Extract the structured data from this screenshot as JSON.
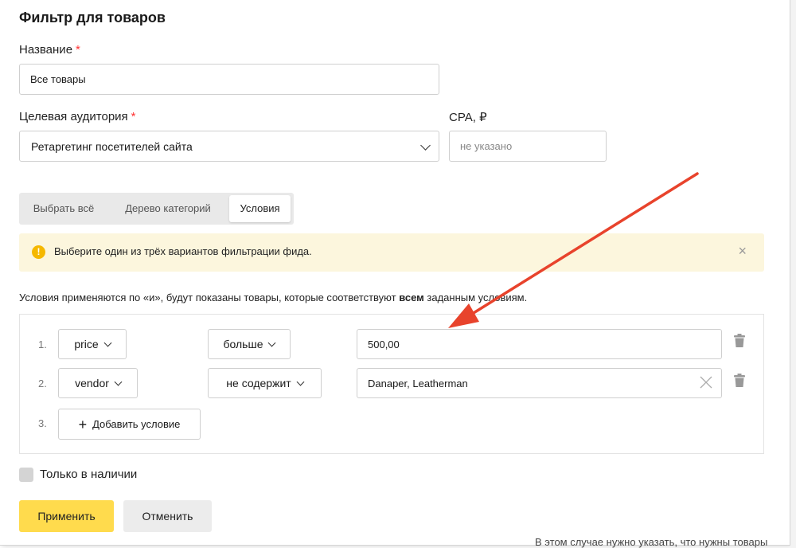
{
  "background": {
    "partial_text": "В этом случае нужно указать, что нужны товары"
  },
  "dialog": {
    "title": "Фильтр для товаров",
    "name_label": "Название",
    "required_mark": "*",
    "name_value": "Все товары",
    "audience_label": "Целевая аудитория",
    "audience_value": "Ретаргетинг посетителей сайта",
    "cpa_label": "CPA, ₽",
    "cpa_placeholder": "не указано"
  },
  "tabs": [
    {
      "label": "Выбрать всё",
      "active": false
    },
    {
      "label": "Дерево категорий",
      "active": false
    },
    {
      "label": "Условия",
      "active": true
    }
  ],
  "alert": {
    "icon": "warning-icon",
    "text": "Выберите один из трёх вариантов фильтрации фида.",
    "close": "×"
  },
  "description": {
    "prefix": "Условия применяются по «и», будут показаны товары, которые соответствуют ",
    "bold": "всем",
    "suffix": " заданным условиям."
  },
  "conditions": [
    {
      "num": "1.",
      "field": "price",
      "operator": "больше",
      "value": "500,00"
    },
    {
      "num": "2.",
      "field": "vendor",
      "operator": "не содержит",
      "value": "Danaper, Leatherman"
    }
  ],
  "add_condition": {
    "num": "3.",
    "label": "Добавить условие",
    "icon": "plus-icon"
  },
  "in_stock_label": "Только в наличии",
  "apply_label": "Применить",
  "cancel_label": "Отменить",
  "colors": {
    "accent": "#ffdb4d",
    "alert_bg": "#fcf6dd",
    "arrow": "#e8432c",
    "required": "#ff3333"
  }
}
